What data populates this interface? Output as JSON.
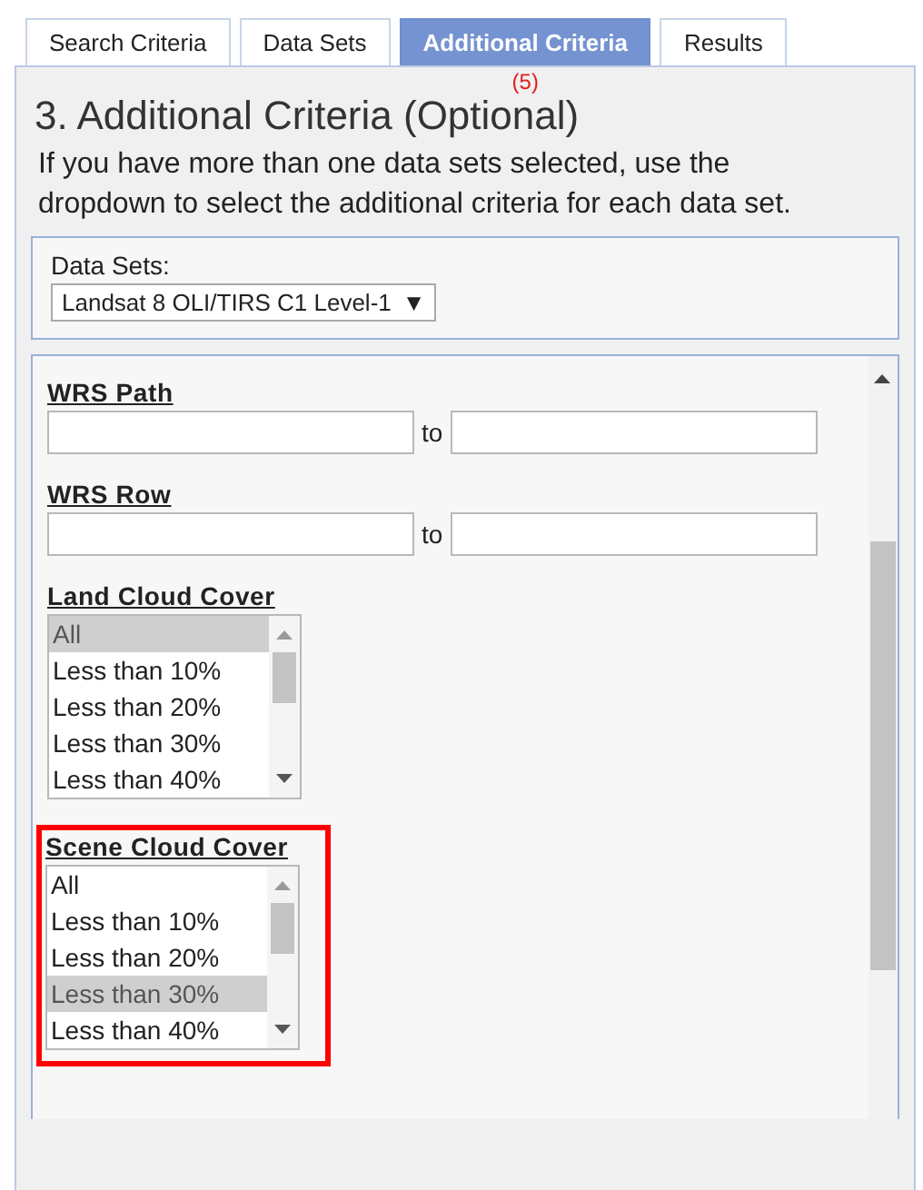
{
  "tabs": [
    {
      "label": "Search Criteria",
      "selected": false
    },
    {
      "label": "Data Sets",
      "selected": false
    },
    {
      "label": "Additional Criteria",
      "selected": true,
      "count": "(5)"
    },
    {
      "label": "Results",
      "selected": false
    }
  ],
  "heading": "3. Additional Criteria (Optional)",
  "description": "If you have more than one data sets selected, use the dropdown to select the additional criteria for each data set.",
  "dataset_select": {
    "label": "Data Sets:",
    "value": "Landsat 8 OLI/TIRS C1 Level-1",
    "arrow": "▼"
  },
  "criteria": [
    {
      "kind": "range",
      "label": "WRS Path",
      "separator": "to",
      "highlighted": false
    },
    {
      "kind": "range",
      "label": "WRS Row",
      "separator": "to",
      "highlighted": false
    },
    {
      "kind": "listbox",
      "label": "Land Cloud Cover",
      "highlighted": false,
      "options": [
        {
          "label": "All",
          "selected": true
        },
        {
          "label": "Less than 10%",
          "selected": false
        },
        {
          "label": "Less than 20%",
          "selected": false
        },
        {
          "label": "Less than 30%",
          "selected": false
        },
        {
          "label": "Less than 40%",
          "selected": false
        }
      ]
    },
    {
      "kind": "listbox",
      "label": "Scene Cloud Cover",
      "highlighted": true,
      "options": [
        {
          "label": "All",
          "selected": false
        },
        {
          "label": "Less than 10%",
          "selected": false
        },
        {
          "label": "Less than 20%",
          "selected": false
        },
        {
          "label": "Less than 30%",
          "selected": true
        },
        {
          "label": "Less than 40%",
          "selected": false
        }
      ]
    }
  ]
}
